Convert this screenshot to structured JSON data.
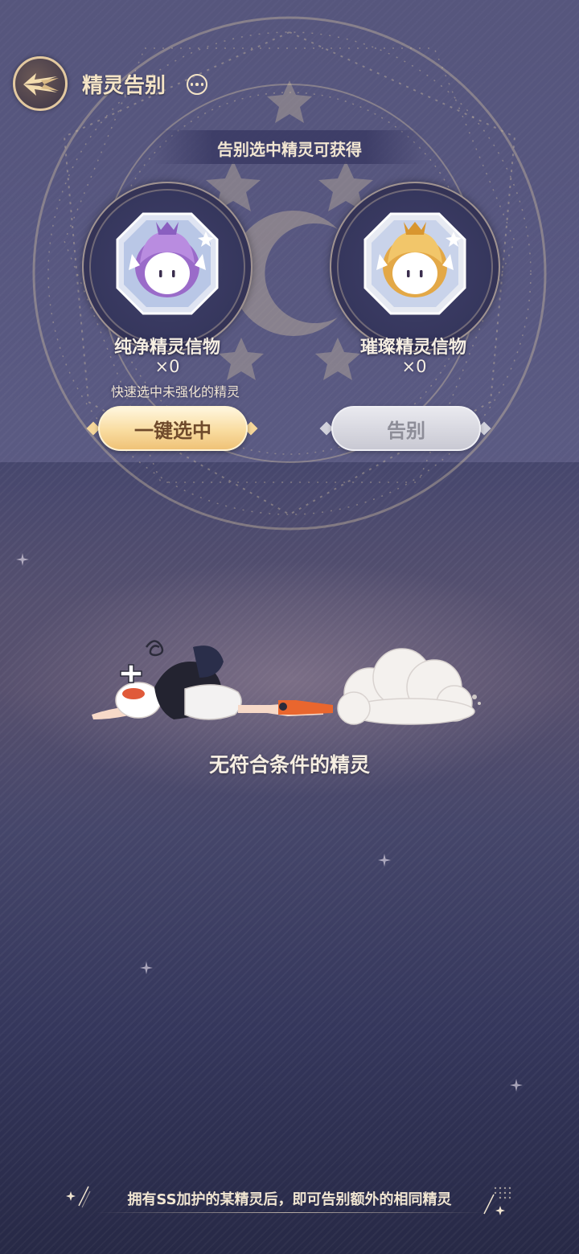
{
  "header": {
    "title": "精灵告别",
    "back_icon": "wing-back-icon",
    "more_icon": "more-icon"
  },
  "rewards": {
    "title": "告别选中精灵可获得",
    "items": [
      {
        "name": "纯净精灵信物",
        "count": "×0",
        "icon": "purple-elf-token-icon"
      },
      {
        "name": "璀璨精灵信物",
        "count": "×0",
        "icon": "gold-elf-token-icon"
      }
    ]
  },
  "actions": {
    "hint": "快速选中未强化的精灵",
    "select_label": "一键选中",
    "farewell_label": "告别"
  },
  "empty_state": {
    "text": "无符合条件的精灵"
  },
  "footer": {
    "tip": "拥有SS加护的某精灵后，即可告别额外的相同精灵"
  },
  "colors": {
    "accent_gold": "#f9dca0",
    "title_cream": "#f4e4c6",
    "disabled_gray": "#c9c9d3"
  }
}
